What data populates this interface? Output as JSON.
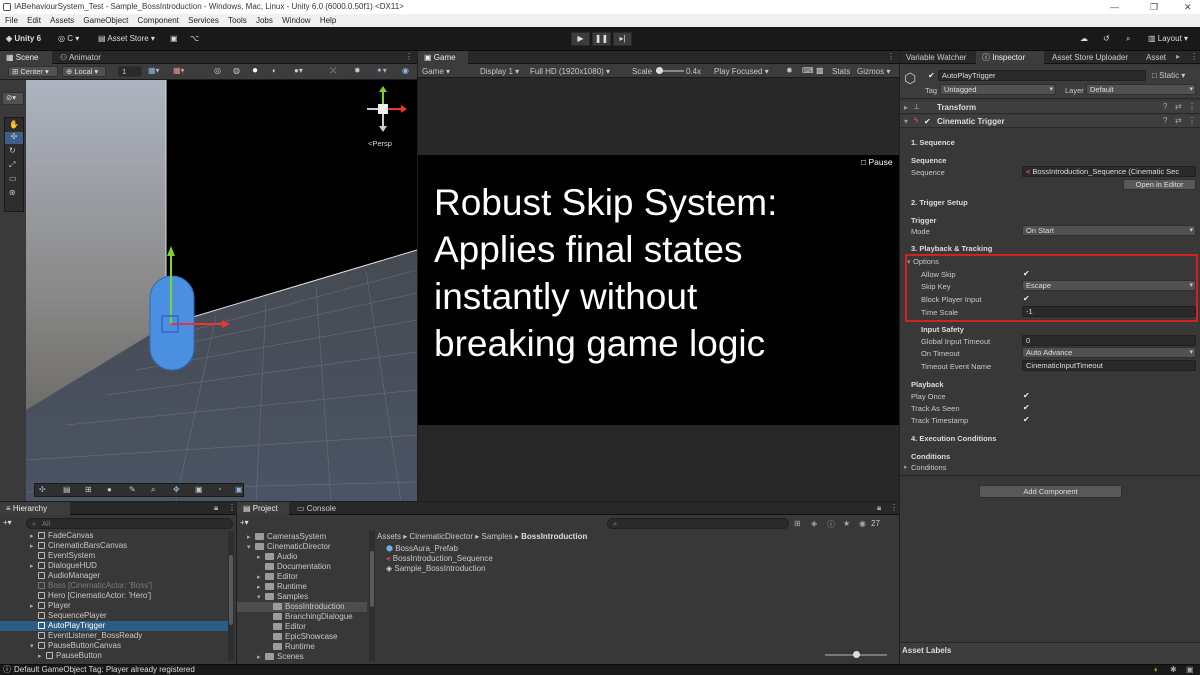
{
  "window": {
    "title": "IABehaviourSystem_Test - Sample_BossIntroduction - Windows, Mac, Linux - Unity 6.0 (6000.0.50f1) <DX11>",
    "minimize": "—",
    "maximize": "❐",
    "close": "✕"
  },
  "menu": [
    "File",
    "Edit",
    "Assets",
    "GameObject",
    "Component",
    "Services",
    "Tools",
    "Jobs",
    "Window",
    "Help"
  ],
  "toolbar": {
    "unity_label": "Unity 6",
    "account_label": "C",
    "asset_store_label": "Asset Store",
    "layout_label": "Layout"
  },
  "scene_view": {
    "tabs": [
      "Scene",
      "Animator"
    ],
    "pivot_label": "Center",
    "space_label": "Local",
    "grid_value": "1",
    "persp_label": "<Persp"
  },
  "game_view": {
    "tab": "Game",
    "mode_label": "Game",
    "display_label": "Display 1",
    "resolution_label": "Full HD (1920x1080)",
    "scale_label": "Scale",
    "scale_value": "0.4x",
    "play_focused_label": "Play Focused",
    "stats_label": "Stats",
    "gizmos_label": "Gizmos",
    "pause_label": "Pause",
    "overlay_lines": [
      "Robust Skip System:",
      "Applies final states",
      "instantly without",
      "breaking game logic"
    ]
  },
  "inspector": {
    "tabs": [
      "Variable Watcher",
      "Inspector",
      "Asset Store Uploader",
      "Asset"
    ],
    "object_name": "AutoPlayTrigger",
    "static_label": "Static",
    "tag_label": "Tag",
    "tag_value": "Untagged",
    "layer_label": "Layer",
    "layer_value": "Default",
    "components": [
      "Transform",
      "Cinematic Trigger"
    ],
    "section_sequence": "1. Sequence",
    "sequence_header": "Sequence",
    "sequence_label": "Sequence",
    "sequence_value": "BossIntroduction_Sequence (Cinematic Sec",
    "open_in_editor": "Open in Editor",
    "section_trigger": "2. Trigger Setup",
    "trigger_header": "Trigger",
    "mode_label": "Mode",
    "mode_value": "On Start",
    "section_playback": "3. Playback & Tracking",
    "options_label": "Options",
    "allow_skip_label": "Allow Skip",
    "skip_key_label": "Skip Key",
    "skip_key_value": "Escape",
    "block_input_label": "Block Player Input",
    "time_scale_label": "Time Scale",
    "time_scale_value": "-1",
    "input_safety_label": "Input Safety",
    "global_timeout_label": "Global Input Timeout",
    "global_timeout_value": "0",
    "on_timeout_label": "On Timeout",
    "on_timeout_value": "Auto Advance",
    "timeout_event_label": "Timeout Event Name",
    "timeout_event_value": "CinematicInputTimeout",
    "playback_header": "Playback",
    "play_once_label": "Play Once",
    "track_seen_label": "Track As Seen",
    "track_timestamp_label": "Track Timestamp",
    "section_execution": "4. Execution Conditions",
    "conditions_header": "Conditions",
    "conditions_label": "Conditions",
    "add_component": "Add Component",
    "asset_labels": "Asset Labels",
    "highlight_color": "#d42020"
  },
  "hierarchy": {
    "tab": "Hierarchy",
    "search_placeholder": "All",
    "items": [
      {
        "label": "FadeCanvas"
      },
      {
        "label": "CinematicBarsCanvas"
      },
      {
        "label": "EventSystem"
      },
      {
        "label": "DialogueHUD"
      },
      {
        "label": "AudioManager"
      },
      {
        "label": "Boss [CinematicActor: 'Boss']"
      },
      {
        "label": "Hero [CinematicActor: 'Hero']"
      },
      {
        "label": "Player"
      },
      {
        "label": "SequencePlayer"
      },
      {
        "label": "AutoPlayTrigger"
      },
      {
        "label": "EventListener_BossReady"
      },
      {
        "label": "PauseButtonCanvas"
      },
      {
        "label": "PauseButton"
      }
    ]
  },
  "project": {
    "tabs": [
      "Project",
      "Console"
    ],
    "console_count": "27",
    "folders": [
      {
        "label": "CamerasSystem"
      },
      {
        "label": "CinematicDirector"
      },
      {
        "label": "Audio"
      },
      {
        "label": "Documentation"
      },
      {
        "label": "Editor"
      },
      {
        "label": "Runtime"
      },
      {
        "label": "Samples"
      },
      {
        "label": "BossIntroduction"
      },
      {
        "label": "BranchingDialogue"
      },
      {
        "label": "Editor"
      },
      {
        "label": "EpicShowcase"
      },
      {
        "label": "Runtime"
      },
      {
        "label": "Scenes"
      }
    ],
    "breadcrumb": [
      "Assets",
      "CinematicDirector",
      "Samples",
      "BossIntroduction"
    ],
    "assets": [
      {
        "label": "BossAura_Prefab"
      },
      {
        "label": "BossIntroduction_Sequence"
      },
      {
        "label": "Sample_BossIntroduction"
      }
    ]
  },
  "status_bar": {
    "message": "Default GameObject Tag: Player already registered"
  }
}
